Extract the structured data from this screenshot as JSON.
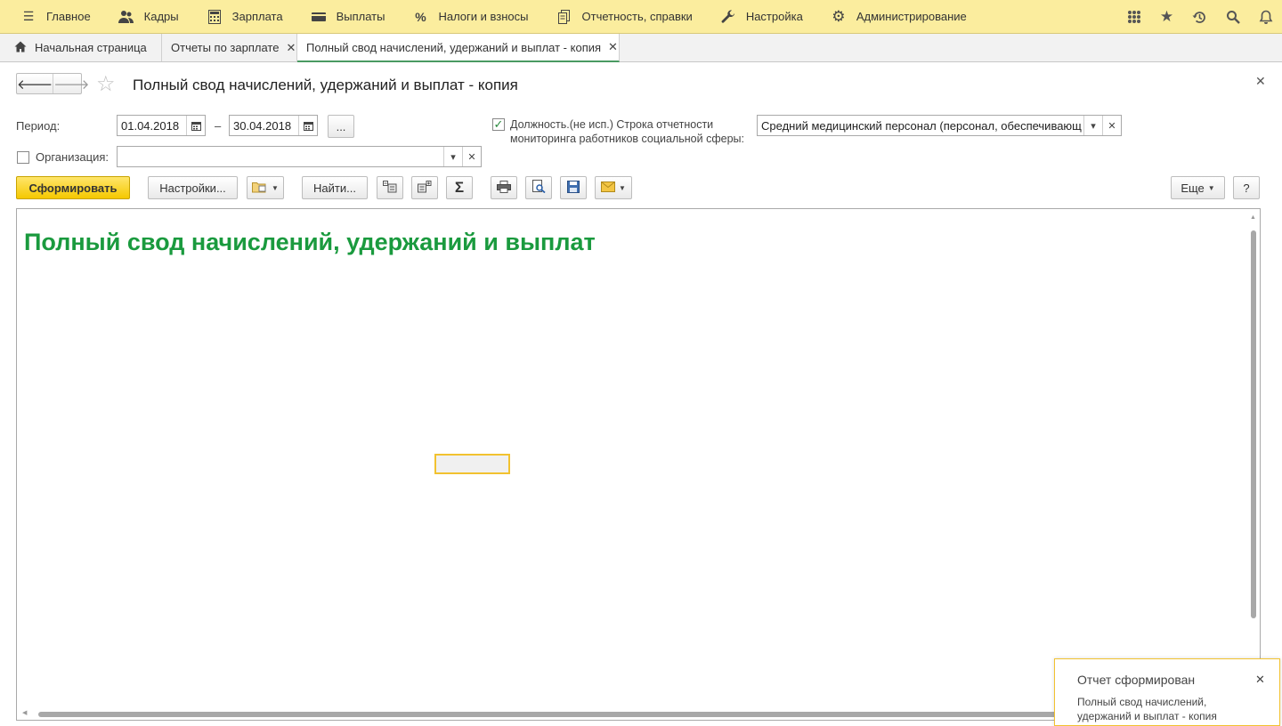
{
  "main_menu": [
    {
      "label": "Главное",
      "icon": "hamburger-icon"
    },
    {
      "label": "Кадры",
      "icon": "people-icon"
    },
    {
      "label": "Зарплата",
      "icon": "calculator-icon"
    },
    {
      "label": "Выплаты",
      "icon": "wallet-icon"
    },
    {
      "label": "Налоги и взносы",
      "icon": "percent-icon"
    },
    {
      "label": "Отчетность, справки",
      "icon": "documents-icon"
    },
    {
      "label": "Настройка",
      "icon": "wrench-icon"
    },
    {
      "label": "Администрирование",
      "icon": "gear-icon"
    }
  ],
  "tabs": [
    {
      "label": "Начальная страница"
    },
    {
      "label": "Отчеты по зарплате"
    },
    {
      "label": "Полный свод начислений, удержаний и выплат - копия"
    }
  ],
  "form": {
    "title": "Полный свод начислений, удержаний и выплат - копия"
  },
  "filters": {
    "period_label": "Период:",
    "period_from": "01.04.2018",
    "period_dash": "–",
    "period_to": "30.04.2018",
    "period_more": "...",
    "position_checked": true,
    "position_label_line1": "Должность.(не исп.) Строка отчетности",
    "position_label_line2": "мониторинга работников социальной сферы:",
    "position_value": "Средний медицинский персонал (персонал, обеспечивающ",
    "org_checked": false,
    "org_label": "Организация:",
    "org_value": ""
  },
  "toolbar": {
    "generate": "Сформировать",
    "settings": "Настройки...",
    "find": "Найти...",
    "more": "Еще",
    "help": "?"
  },
  "report": {
    "title": "Полный свод начислений, удержаний и выплат"
  },
  "notification": {
    "title": "Отчет сформирован",
    "text": "Полный свод начислений, удержаний и выплат - копия"
  },
  "colors": {
    "topbar": "#fbed9e",
    "primary_button": "#f5c800",
    "report_title": "#1a9a3e",
    "active_tab_underline": "#4a9a62"
  }
}
